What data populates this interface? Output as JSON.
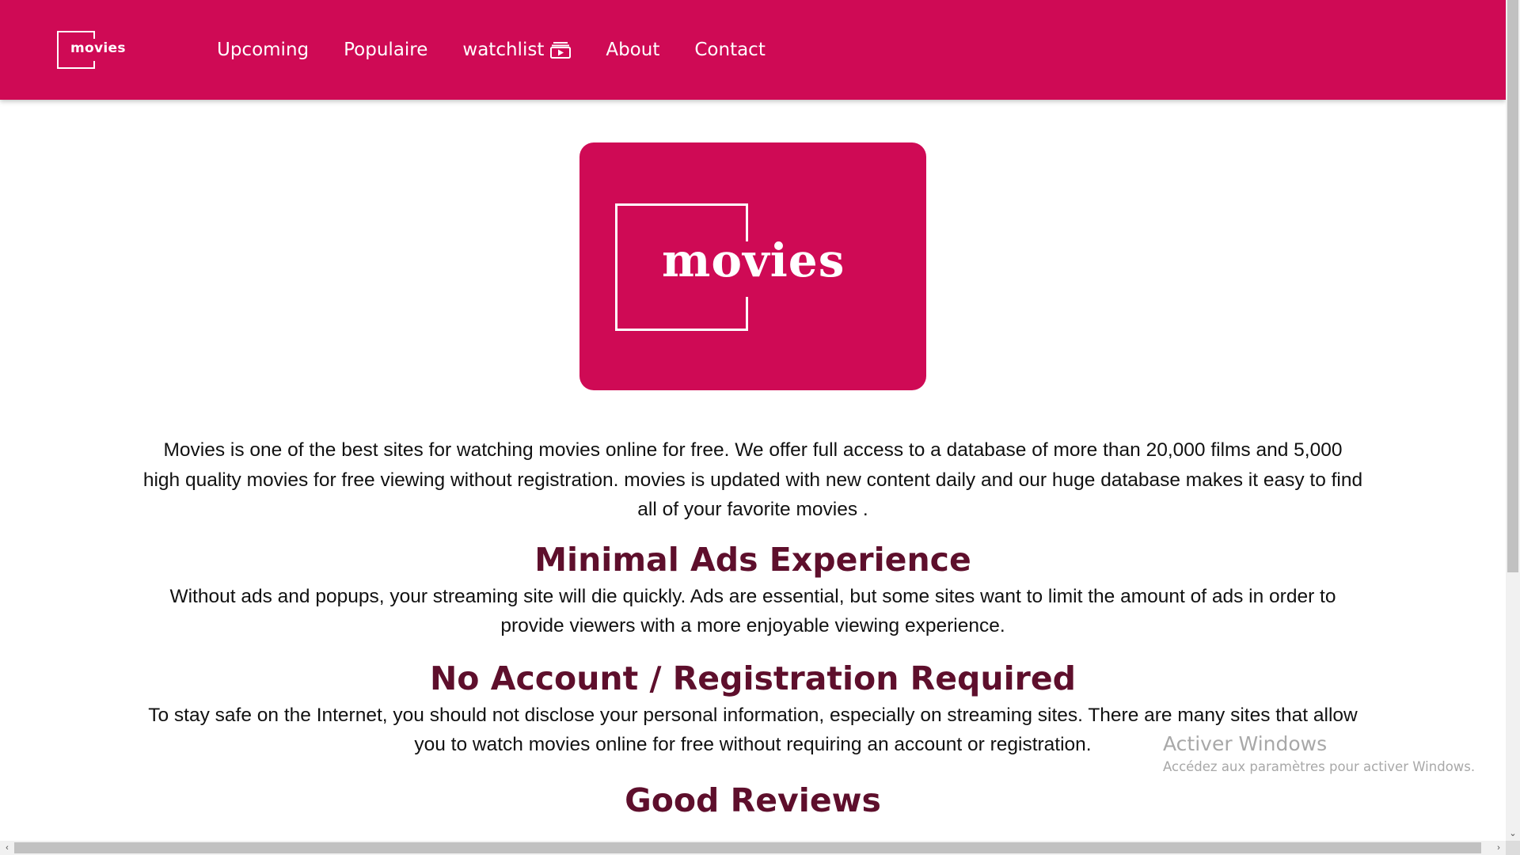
{
  "brand": {
    "logo_text": "movies",
    "color": "#cf0a55",
    "heading_color": "#5e0f2c"
  },
  "nav": {
    "items": [
      {
        "label": "Upcoming"
      },
      {
        "label": "Populaire"
      },
      {
        "label": "watchlist",
        "icon": "watchlist-play-icon"
      },
      {
        "label": "About"
      },
      {
        "label": "Contact"
      }
    ]
  },
  "hero": {
    "logo_text": "movies"
  },
  "content": {
    "intro": "Movies is one of the best sites for watching movies online for free. We offer full access to a database of more than 20,000 films and 5,000 high quality movies for free viewing without registration. movies is updated with new content daily and our huge database makes it easy to find all of your favorite movies .",
    "sections": [
      {
        "title": "Minimal Ads Experience",
        "text": "Without ads and popups, your streaming site will die quickly. Ads are essential, but some sites want to limit the amount of ads in order to provide viewers with a more enjoyable viewing experience."
      },
      {
        "title": "No Account / Registration Required",
        "text": "To stay safe on the Internet, you should not disclose your personal information, especially on streaming sites. There are many sites that allow you to watch movies online for free without requiring an account or registration."
      },
      {
        "title": "Good Reviews"
      }
    ]
  },
  "watermark": {
    "line1": "Activer Windows",
    "line2": "Accédez aux paramètres pour activer Windows."
  },
  "scrollbar": {
    "left_arrow": "‹",
    "right_arrow": "›",
    "down_arrow": "⌄"
  }
}
